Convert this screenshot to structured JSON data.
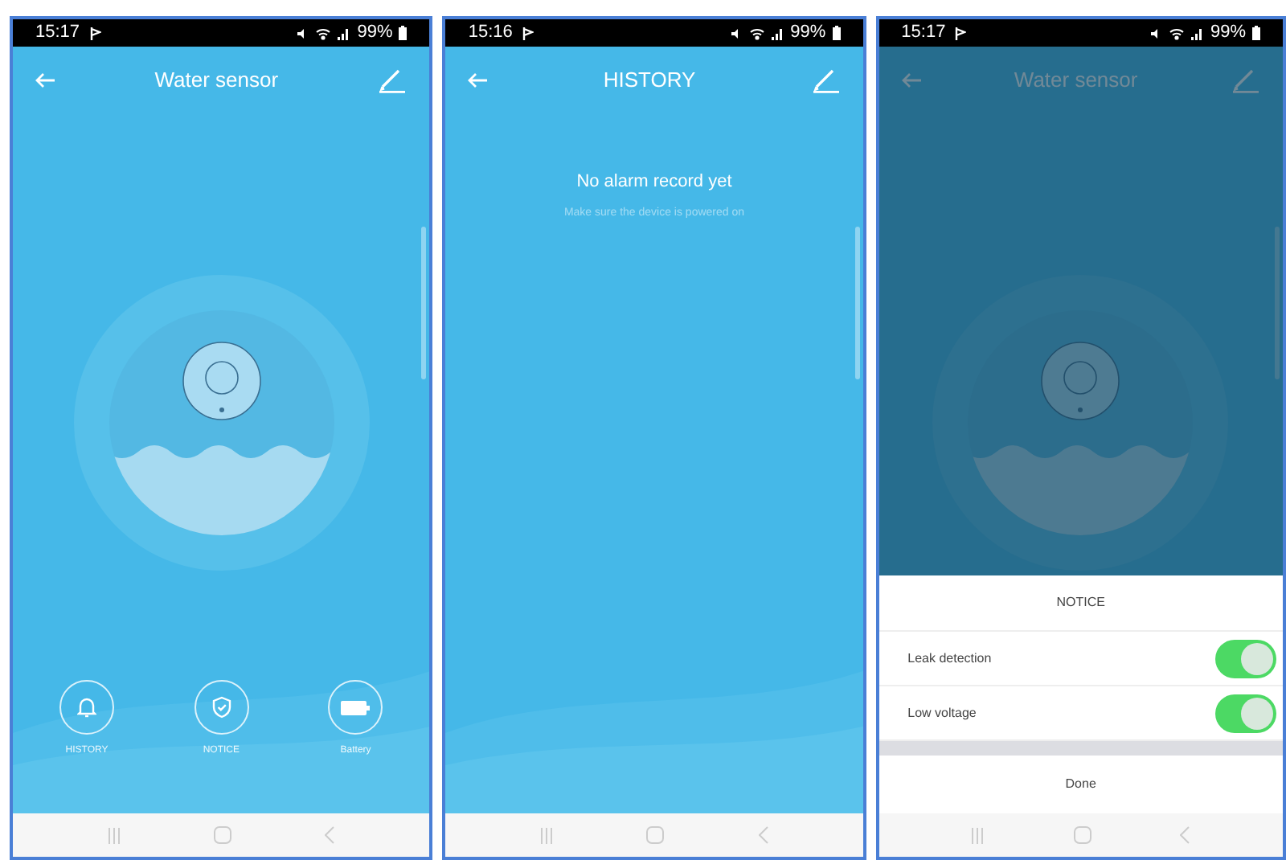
{
  "screens": [
    {
      "kind": "device",
      "dimmed": false,
      "status_bar": {
        "time": "15:17",
        "battery": "99%"
      },
      "title": "Water sensor",
      "actions": [
        {
          "kind": "history",
          "label": "HISTORY"
        },
        {
          "kind": "notice",
          "label": "NOTICE"
        },
        {
          "kind": "battery",
          "label": "Battery"
        }
      ]
    },
    {
      "kind": "history",
      "dimmed": false,
      "status_bar": {
        "time": "15:16",
        "battery": "99%"
      },
      "title": "HISTORY",
      "empty_title": "No alarm record yet",
      "empty_hint": "Make sure the device is powered on"
    },
    {
      "kind": "device",
      "dimmed": true,
      "status_bar": {
        "time": "15:17",
        "battery": "99%"
      },
      "title": "Water sensor",
      "sheet": {
        "title": "NOTICE",
        "options": [
          {
            "label": "Leak detection",
            "on": true
          },
          {
            "label": "Low voltage",
            "on": true
          }
        ],
        "button": "Done"
      }
    }
  ]
}
